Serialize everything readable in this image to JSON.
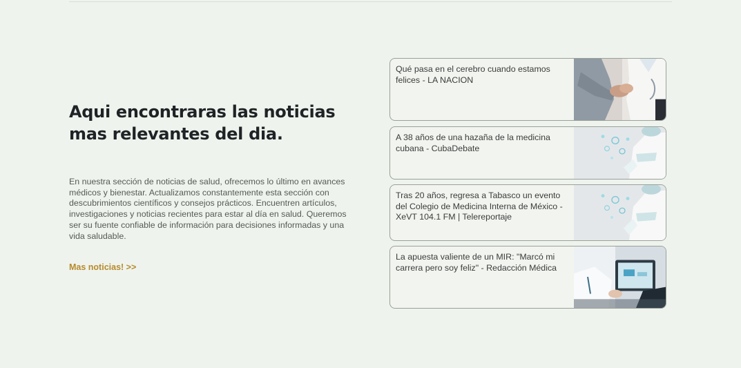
{
  "section": {
    "heading_line1": "Aqui encontraras las noticias",
    "heading_line2": "mas relevantes del dia.",
    "description": "En nuestra sección de noticias de salud, ofrecemos lo último en avances médicos y bienestar. Actualizamos constantemente esta sección con descubrimientos científicos y consejos prácticos. Encuentren artículos, investigaciones y noticias recientes para estar al día en salud. Queremos ser su fuente confiable de información para decisiones informadas y una vida saludable.",
    "more_link": "Mas noticias! >>"
  },
  "news": [
    {
      "title": "Qué pasa en el cerebro cuando estamos felices - LA NACION",
      "image": "hands-holding-photo"
    },
    {
      "title": "A 38 años de una hazaña de la medicina cubana - CubaDebate",
      "image": "doctor-virus-photo"
    },
    {
      "title": "Tras 20 años, regresa a Tabasco un evento del Colegio de Medicina Interna de México - XeVT 104.1 FM | Telereportaje",
      "image": "doctor-virus-photo"
    },
    {
      "title": "La apuesta valiente de un MIR: \"Marcó mi carrera pero soy feliz\" - Redacción Médica",
      "image": "doctor-tablet-photo"
    }
  ],
  "colors": {
    "background": "#eff3ed",
    "accent": "#b68b2c",
    "heading": "#1f2326",
    "card_border": "#9aa197"
  }
}
